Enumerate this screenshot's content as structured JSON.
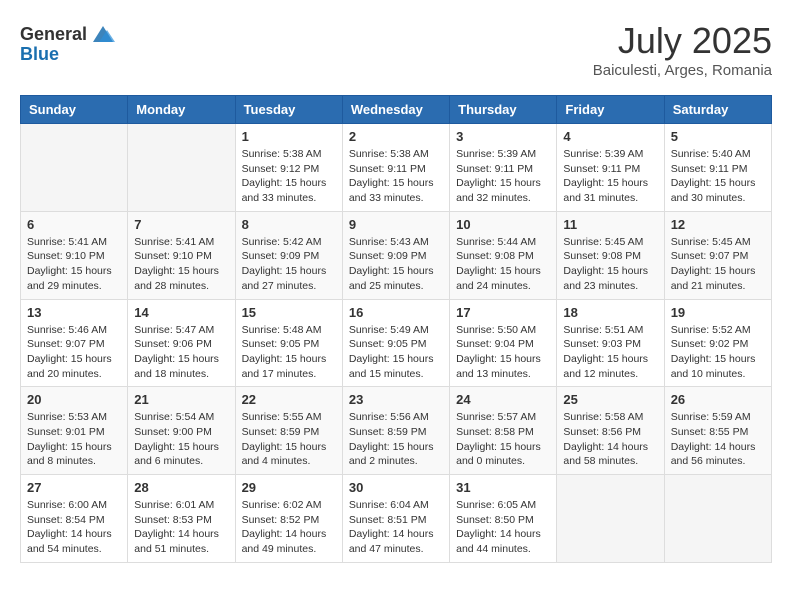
{
  "header": {
    "logo_general": "General",
    "logo_blue": "Blue",
    "month_year": "July 2025",
    "location": "Baiculesti, Arges, Romania"
  },
  "days_of_week": [
    "Sunday",
    "Monday",
    "Tuesday",
    "Wednesday",
    "Thursday",
    "Friday",
    "Saturday"
  ],
  "weeks": [
    [
      {
        "day": "",
        "info": ""
      },
      {
        "day": "",
        "info": ""
      },
      {
        "day": "1",
        "info": "Sunrise: 5:38 AM\nSunset: 9:12 PM\nDaylight: 15 hours and 33 minutes."
      },
      {
        "day": "2",
        "info": "Sunrise: 5:38 AM\nSunset: 9:11 PM\nDaylight: 15 hours and 33 minutes."
      },
      {
        "day": "3",
        "info": "Sunrise: 5:39 AM\nSunset: 9:11 PM\nDaylight: 15 hours and 32 minutes."
      },
      {
        "day": "4",
        "info": "Sunrise: 5:39 AM\nSunset: 9:11 PM\nDaylight: 15 hours and 31 minutes."
      },
      {
        "day": "5",
        "info": "Sunrise: 5:40 AM\nSunset: 9:11 PM\nDaylight: 15 hours and 30 minutes."
      }
    ],
    [
      {
        "day": "6",
        "info": "Sunrise: 5:41 AM\nSunset: 9:10 PM\nDaylight: 15 hours and 29 minutes."
      },
      {
        "day": "7",
        "info": "Sunrise: 5:41 AM\nSunset: 9:10 PM\nDaylight: 15 hours and 28 minutes."
      },
      {
        "day": "8",
        "info": "Sunrise: 5:42 AM\nSunset: 9:09 PM\nDaylight: 15 hours and 27 minutes."
      },
      {
        "day": "9",
        "info": "Sunrise: 5:43 AM\nSunset: 9:09 PM\nDaylight: 15 hours and 25 minutes."
      },
      {
        "day": "10",
        "info": "Sunrise: 5:44 AM\nSunset: 9:08 PM\nDaylight: 15 hours and 24 minutes."
      },
      {
        "day": "11",
        "info": "Sunrise: 5:45 AM\nSunset: 9:08 PM\nDaylight: 15 hours and 23 minutes."
      },
      {
        "day": "12",
        "info": "Sunrise: 5:45 AM\nSunset: 9:07 PM\nDaylight: 15 hours and 21 minutes."
      }
    ],
    [
      {
        "day": "13",
        "info": "Sunrise: 5:46 AM\nSunset: 9:07 PM\nDaylight: 15 hours and 20 minutes."
      },
      {
        "day": "14",
        "info": "Sunrise: 5:47 AM\nSunset: 9:06 PM\nDaylight: 15 hours and 18 minutes."
      },
      {
        "day": "15",
        "info": "Sunrise: 5:48 AM\nSunset: 9:05 PM\nDaylight: 15 hours and 17 minutes."
      },
      {
        "day": "16",
        "info": "Sunrise: 5:49 AM\nSunset: 9:05 PM\nDaylight: 15 hours and 15 minutes."
      },
      {
        "day": "17",
        "info": "Sunrise: 5:50 AM\nSunset: 9:04 PM\nDaylight: 15 hours and 13 minutes."
      },
      {
        "day": "18",
        "info": "Sunrise: 5:51 AM\nSunset: 9:03 PM\nDaylight: 15 hours and 12 minutes."
      },
      {
        "day": "19",
        "info": "Sunrise: 5:52 AM\nSunset: 9:02 PM\nDaylight: 15 hours and 10 minutes."
      }
    ],
    [
      {
        "day": "20",
        "info": "Sunrise: 5:53 AM\nSunset: 9:01 PM\nDaylight: 15 hours and 8 minutes."
      },
      {
        "day": "21",
        "info": "Sunrise: 5:54 AM\nSunset: 9:00 PM\nDaylight: 15 hours and 6 minutes."
      },
      {
        "day": "22",
        "info": "Sunrise: 5:55 AM\nSunset: 8:59 PM\nDaylight: 15 hours and 4 minutes."
      },
      {
        "day": "23",
        "info": "Sunrise: 5:56 AM\nSunset: 8:59 PM\nDaylight: 15 hours and 2 minutes."
      },
      {
        "day": "24",
        "info": "Sunrise: 5:57 AM\nSunset: 8:58 PM\nDaylight: 15 hours and 0 minutes."
      },
      {
        "day": "25",
        "info": "Sunrise: 5:58 AM\nSunset: 8:56 PM\nDaylight: 14 hours and 58 minutes."
      },
      {
        "day": "26",
        "info": "Sunrise: 5:59 AM\nSunset: 8:55 PM\nDaylight: 14 hours and 56 minutes."
      }
    ],
    [
      {
        "day": "27",
        "info": "Sunrise: 6:00 AM\nSunset: 8:54 PM\nDaylight: 14 hours and 54 minutes."
      },
      {
        "day": "28",
        "info": "Sunrise: 6:01 AM\nSunset: 8:53 PM\nDaylight: 14 hours and 51 minutes."
      },
      {
        "day": "29",
        "info": "Sunrise: 6:02 AM\nSunset: 8:52 PM\nDaylight: 14 hours and 49 minutes."
      },
      {
        "day": "30",
        "info": "Sunrise: 6:04 AM\nSunset: 8:51 PM\nDaylight: 14 hours and 47 minutes."
      },
      {
        "day": "31",
        "info": "Sunrise: 6:05 AM\nSunset: 8:50 PM\nDaylight: 14 hours and 44 minutes."
      },
      {
        "day": "",
        "info": ""
      },
      {
        "day": "",
        "info": ""
      }
    ]
  ]
}
